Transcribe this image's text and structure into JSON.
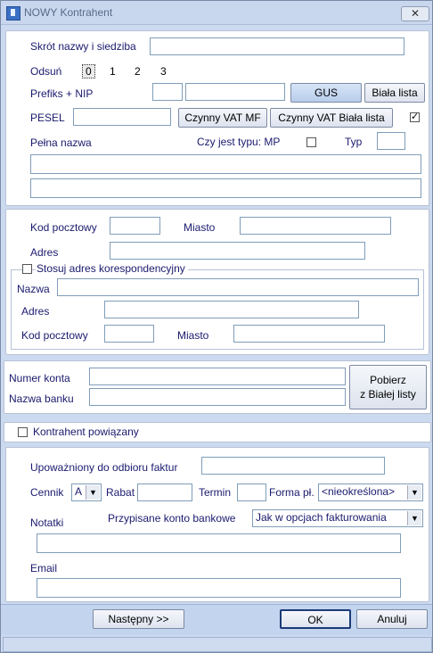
{
  "window": {
    "title": "NOWY Kontrahent",
    "close_label": "✕"
  },
  "section1": {
    "skrot_label": "Skrót nazwy i siedziba",
    "odsun_label": "Odsuń",
    "odsun_options": [
      "0",
      "1",
      "2",
      "3"
    ],
    "prefiks_label": "Prefiks + NIP",
    "gus_button": "GUS",
    "biala_lista_button": "Biała lista",
    "pesel_label": "PESEL",
    "czynny_vat_mf_button": "Czynny VAT MF",
    "czynny_vat_biala_button": "Czynny VAT Biała lista",
    "pelna_nazwa_label": "Pełna  nazwa",
    "czy_mp_label": "Czy jest typu: MP",
    "typ_label": "Typ"
  },
  "section2": {
    "kod_label": "Kod pocztowy",
    "miasto_label": "Miasto",
    "adres_label": "Adres",
    "stosuj_label": "Stosuj adres korespondencyjny",
    "k_nazwa_label": "Nazwa",
    "k_adres_label": "Adres",
    "k_kod_label": "Kod pocztowy",
    "k_miasto_label": "Miasto"
  },
  "section3": {
    "numer_konta_label": "Numer konta",
    "nazwa_banku_label": "Nazwa banku",
    "pobierz_line1": "Pobierz",
    "pobierz_line2": "z Białej listy"
  },
  "section4": {
    "powiazany_label": "Kontrahent powiązany"
  },
  "section5": {
    "upowazniony_label": "Upoważniony do odbioru faktur",
    "cennik_label": "Cennik",
    "cennik_value": "A",
    "rabat_label": "Rabat",
    "termin_label": "Termin",
    "forma_label": "Forma pł.",
    "forma_value": "<nieokreślona>",
    "notatki_label": "Notatki",
    "przypisane_label": "Przypisane konto bankowe",
    "przypisane_value": "Jak w opcjach fakturowania",
    "email_label": "Email"
  },
  "footer": {
    "nastepny_label": "Następny >>",
    "ok_label": "OK",
    "anuluj_label": "Anuluj"
  }
}
